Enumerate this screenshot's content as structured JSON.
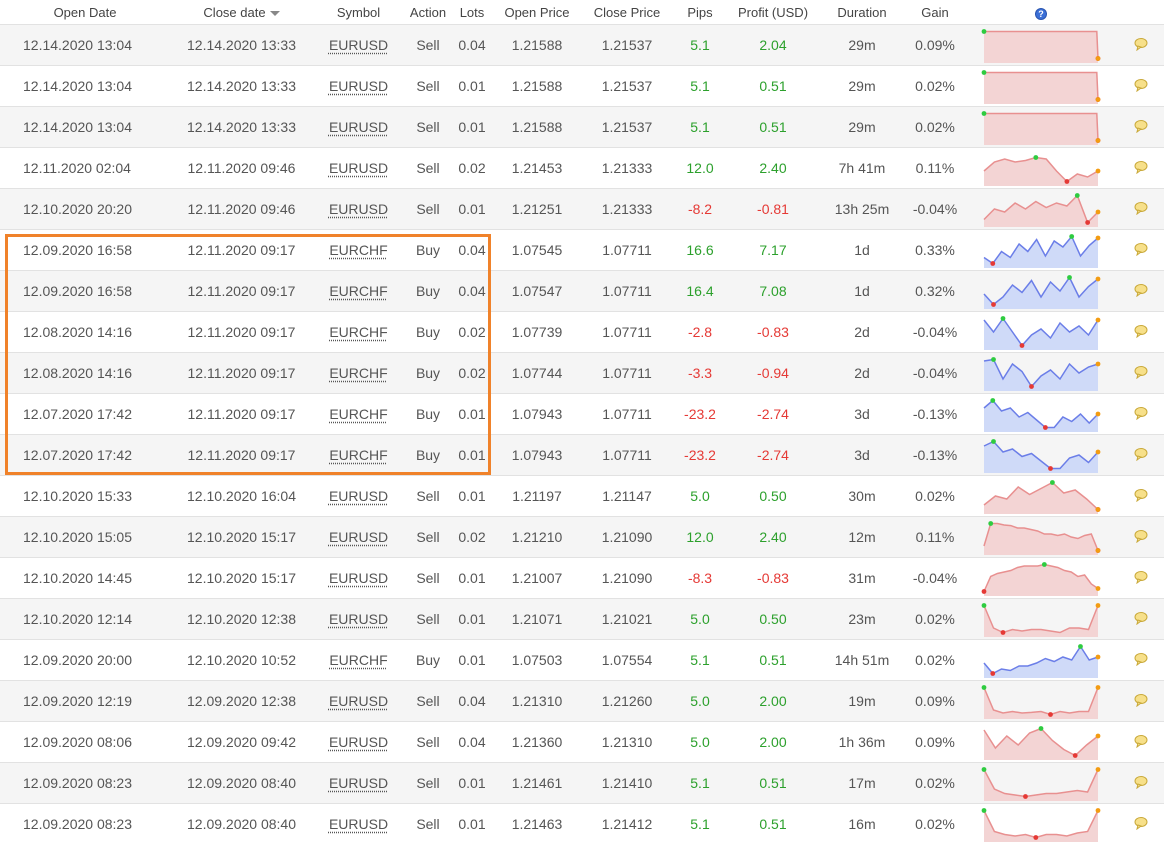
{
  "columns": {
    "open_date": "Open Date",
    "close_date": "Close date",
    "symbol": "Symbol",
    "action": "Action",
    "lots": "Lots",
    "open_price": "Open Price",
    "close_price": "Close Price",
    "pips": "Pips",
    "profit": "Profit (USD)",
    "duration": "Duration",
    "gain": "Gain",
    "help_icon_glyph": "?"
  },
  "colors": {
    "positive": "#2ca02c",
    "negative": "#e53935",
    "highlight_border": "#f0822a",
    "sell_line": "#e89090",
    "sell_fill": "#f3d4d4",
    "buy_line": "#6b7ee8",
    "buy_fill": "#cfdaf8"
  },
  "highlighted_rows": [
    5,
    6,
    7,
    8,
    9,
    10
  ],
  "rows": [
    {
      "open": "12.14.2020 13:04",
      "close": "12.14.2020 13:33",
      "symbol": "EURUSD",
      "action": "Sell",
      "lots": "0.04",
      "open_price": "1.21588",
      "close_price": "1.21537",
      "pips": "5.1",
      "profit": "2.04",
      "duration": "29m",
      "gain": "0.09%",
      "spark": [
        0.05,
        0.05,
        0.05,
        0.05,
        0.05,
        0.05,
        0.05,
        0.05,
        0.05,
        0.05,
        0.05,
        0.05,
        0.05,
        0.05,
        0.05,
        0.05,
        0.05,
        0.05,
        0.05,
        0.05,
        0.05,
        0.05,
        0.05,
        0.05,
        0.05,
        0.05,
        0.05,
        0.05,
        0.05,
        0.05,
        0.05,
        0.05,
        0.05,
        0.05,
        0.05,
        0.05,
        0.05,
        0.05,
        0.05,
        0.05,
        0.05,
        0.05,
        0.05,
        0.05,
        0.05,
        0.05,
        0.05,
        0.05,
        0.05,
        0.05,
        0.05,
        0.05,
        0.05,
        0.05,
        0.05,
        0.05,
        0.05,
        0.05,
        0.05,
        0.05,
        0.05,
        0.05,
        0.05,
        0.05,
        0.05,
        0.05,
        0.05,
        0.05,
        0.05,
        0.05,
        0.05,
        0.05,
        0.05,
        0.05,
        0.05,
        0.05,
        0.05,
        0.05,
        0.05,
        0.05,
        0.05,
        0.05,
        0.05,
        0.05,
        0.05,
        0.05,
        0.05,
        0.05,
        0.05,
        0.05,
        0.05,
        0.05,
        0.05,
        0.05,
        0.05,
        0.95
      ]
    },
    {
      "open": "12.14.2020 13:04",
      "close": "12.14.2020 13:33",
      "symbol": "EURUSD",
      "action": "Sell",
      "lots": "0.01",
      "open_price": "1.21588",
      "close_price": "1.21537",
      "pips": "5.1",
      "profit": "0.51",
      "duration": "29m",
      "gain": "0.02%",
      "spark": [
        0.05,
        0.05,
        0.05,
        0.05,
        0.05,
        0.05,
        0.05,
        0.05,
        0.05,
        0.05,
        0.05,
        0.05,
        0.05,
        0.05,
        0.05,
        0.05,
        0.05,
        0.05,
        0.05,
        0.05,
        0.05,
        0.05,
        0.05,
        0.05,
        0.05,
        0.05,
        0.05,
        0.05,
        0.05,
        0.05,
        0.05,
        0.05,
        0.05,
        0.05,
        0.05,
        0.05,
        0.05,
        0.05,
        0.05,
        0.05,
        0.05,
        0.05,
        0.05,
        0.05,
        0.05,
        0.05,
        0.05,
        0.05,
        0.05,
        0.05,
        0.05,
        0.05,
        0.05,
        0.05,
        0.05,
        0.05,
        0.05,
        0.05,
        0.05,
        0.05,
        0.05,
        0.05,
        0.05,
        0.05,
        0.05,
        0.05,
        0.05,
        0.05,
        0.05,
        0.05,
        0.05,
        0.05,
        0.05,
        0.05,
        0.05,
        0.05,
        0.05,
        0.05,
        0.05,
        0.05,
        0.05,
        0.05,
        0.05,
        0.05,
        0.05,
        0.05,
        0.05,
        0.05,
        0.05,
        0.05,
        0.05,
        0.05,
        0.05,
        0.05,
        0.05,
        0.95
      ]
    },
    {
      "open": "12.14.2020 13:04",
      "close": "12.14.2020 13:33",
      "symbol": "EURUSD",
      "action": "Sell",
      "lots": "0.01",
      "open_price": "1.21588",
      "close_price": "1.21537",
      "pips": "5.1",
      "profit": "0.51",
      "duration": "29m",
      "gain": "0.02%",
      "spark": [
        0.05,
        0.05,
        0.05,
        0.05,
        0.05,
        0.05,
        0.05,
        0.05,
        0.05,
        0.05,
        0.05,
        0.05,
        0.05,
        0.05,
        0.05,
        0.05,
        0.05,
        0.05,
        0.05,
        0.05,
        0.05,
        0.05,
        0.05,
        0.05,
        0.05,
        0.05,
        0.05,
        0.05,
        0.05,
        0.05,
        0.05,
        0.05,
        0.05,
        0.05,
        0.05,
        0.05,
        0.05,
        0.05,
        0.05,
        0.05,
        0.05,
        0.05,
        0.05,
        0.05,
        0.05,
        0.05,
        0.05,
        0.05,
        0.05,
        0.05,
        0.05,
        0.05,
        0.05,
        0.05,
        0.05,
        0.05,
        0.05,
        0.05,
        0.05,
        0.05,
        0.05,
        0.05,
        0.05,
        0.05,
        0.05,
        0.05,
        0.05,
        0.05,
        0.05,
        0.05,
        0.05,
        0.05,
        0.05,
        0.05,
        0.05,
        0.05,
        0.05,
        0.05,
        0.05,
        0.05,
        0.05,
        0.05,
        0.05,
        0.05,
        0.05,
        0.05,
        0.05,
        0.05,
        0.05,
        0.05,
        0.05,
        0.05,
        0.05,
        0.05,
        0.05,
        0.95
      ]
    },
    {
      "open": "12.11.2020 02:04",
      "close": "12.11.2020 09:46",
      "symbol": "EURUSD",
      "action": "Sell",
      "lots": "0.02",
      "open_price": "1.21453",
      "close_price": "1.21333",
      "pips": "12.0",
      "profit": "2.40",
      "duration": "7h 41m",
      "gain": "0.11%",
      "spark": [
        0.6,
        0.3,
        0.2,
        0.3,
        0.25,
        0.15,
        0.2,
        0.6,
        0.95,
        0.7,
        0.8,
        0.6
      ]
    },
    {
      "open": "12.10.2020 20:20",
      "close": "12.11.2020 09:46",
      "symbol": "EURUSD",
      "action": "Sell",
      "lots": "0.01",
      "open_price": "1.21251",
      "close_price": "1.21333",
      "pips": "-8.2",
      "profit": "-0.81",
      "duration": "13h 25m",
      "gain": "-0.04%",
      "spark": [
        0.85,
        0.5,
        0.6,
        0.3,
        0.5,
        0.25,
        0.45,
        0.3,
        0.4,
        0.05,
        0.95,
        0.6
      ]
    },
    {
      "open": "12.09.2020 16:58",
      "close": "12.11.2020 09:17",
      "symbol": "EURCHF",
      "action": "Buy",
      "lots": "0.04",
      "open_price": "1.07545",
      "close_price": "1.07711",
      "pips": "16.6",
      "profit": "7.17",
      "duration": "1d",
      "gain": "0.33%",
      "spark": [
        0.75,
        0.95,
        0.55,
        0.75,
        0.3,
        0.55,
        0.15,
        0.7,
        0.2,
        0.4,
        0.05,
        0.7,
        0.35,
        0.1
      ]
    },
    {
      "open": "12.09.2020 16:58",
      "close": "12.11.2020 09:17",
      "symbol": "EURCHF",
      "action": "Buy",
      "lots": "0.04",
      "open_price": "1.07547",
      "close_price": "1.07711",
      "pips": "16.4",
      "profit": "7.08",
      "duration": "1d",
      "gain": "0.32%",
      "spark": [
        0.6,
        0.95,
        0.7,
        0.3,
        0.55,
        0.15,
        0.7,
        0.2,
        0.5,
        0.05,
        0.7,
        0.35,
        0.1
      ]
    },
    {
      "open": "12.08.2020 14:16",
      "close": "12.11.2020 09:17",
      "symbol": "EURCHF",
      "action": "Buy",
      "lots": "0.02",
      "open_price": "1.07739",
      "close_price": "1.07711",
      "pips": "-2.8",
      "profit": "-0.83",
      "duration": "2d",
      "gain": "-0.04%",
      "spark": [
        0.1,
        0.5,
        0.05,
        0.5,
        0.95,
        0.6,
        0.4,
        0.7,
        0.2,
        0.5,
        0.3,
        0.6,
        0.1
      ]
    },
    {
      "open": "12.08.2020 14:16",
      "close": "12.11.2020 09:17",
      "symbol": "EURCHF",
      "action": "Buy",
      "lots": "0.02",
      "open_price": "1.07744",
      "close_price": "1.07711",
      "pips": "-3.3",
      "profit": "-0.94",
      "duration": "2d",
      "gain": "-0.04%",
      "spark": [
        0.1,
        0.05,
        0.7,
        0.2,
        0.45,
        0.95,
        0.6,
        0.4,
        0.7,
        0.2,
        0.5,
        0.3,
        0.2
      ]
    },
    {
      "open": "12.07.2020 17:42",
      "close": "12.11.2020 09:17",
      "symbol": "EURCHF",
      "action": "Buy",
      "lots": "0.01",
      "open_price": "1.07943",
      "close_price": "1.07711",
      "pips": "-23.2",
      "profit": "-2.74",
      "duration": "3d",
      "gain": "-0.13%",
      "spark": [
        0.3,
        0.05,
        0.4,
        0.3,
        0.6,
        0.45,
        0.7,
        0.95,
        0.95,
        0.6,
        0.75,
        0.5,
        0.8,
        0.5
      ]
    },
    {
      "open": "12.07.2020 17:42",
      "close": "12.11.2020 09:17",
      "symbol": "EURCHF",
      "action": "Buy",
      "lots": "0.01",
      "open_price": "1.07943",
      "close_price": "1.07711",
      "pips": "-23.2",
      "profit": "-2.74",
      "duration": "3d",
      "gain": "-0.13%",
      "spark": [
        0.2,
        0.05,
        0.4,
        0.3,
        0.55,
        0.45,
        0.7,
        0.95,
        0.95,
        0.6,
        0.5,
        0.75,
        0.4
      ]
    },
    {
      "open": "12.10.2020 15:33",
      "close": "12.10.2020 16:04",
      "symbol": "EURUSD",
      "action": "Sell",
      "lots": "0.01",
      "open_price": "1.21197",
      "close_price": "1.21147",
      "pips": "5.0",
      "profit": "0.50",
      "duration": "30m",
      "gain": "0.02%",
      "spark": [
        0.8,
        0.5,
        0.6,
        0.2,
        0.45,
        0.25,
        0.05,
        0.4,
        0.3,
        0.6,
        0.95
      ]
    },
    {
      "open": "12.10.2020 15:05",
      "close": "12.10.2020 15:17",
      "symbol": "EURUSD",
      "action": "Sell",
      "lots": "0.02",
      "open_price": "1.21210",
      "close_price": "1.21090",
      "pips": "12.0",
      "profit": "2.40",
      "duration": "12m",
      "gain": "0.11%",
      "spark": [
        0.8,
        0.05,
        0.05,
        0.1,
        0.12,
        0.2,
        0.2,
        0.25,
        0.3,
        0.4,
        0.4,
        0.45,
        0.4,
        0.5,
        0.55,
        0.45,
        0.4,
        0.95
      ]
    },
    {
      "open": "12.10.2020 14:45",
      "close": "12.10.2020 15:17",
      "symbol": "EURUSD",
      "action": "Sell",
      "lots": "0.01",
      "open_price": "1.21007",
      "close_price": "1.21090",
      "pips": "-8.3",
      "profit": "-0.83",
      "duration": "31m",
      "gain": "-0.04%",
      "spark": [
        0.95,
        0.45,
        0.35,
        0.3,
        0.25,
        0.15,
        0.1,
        0.1,
        0.1,
        0.05,
        0.1,
        0.15,
        0.25,
        0.3,
        0.45,
        0.4,
        0.7,
        0.85
      ]
    },
    {
      "open": "12.10.2020 12:14",
      "close": "12.10.2020 12:38",
      "symbol": "EURUSD",
      "action": "Sell",
      "lots": "0.01",
      "open_price": "1.21071",
      "close_price": "1.21021",
      "pips": "5.0",
      "profit": "0.50",
      "duration": "23m",
      "gain": "0.02%",
      "spark": [
        0.05,
        0.8,
        0.95,
        0.85,
        0.9,
        0.85,
        0.85,
        0.9,
        0.95,
        0.8,
        0.8,
        0.85,
        0.05
      ]
    },
    {
      "open": "12.09.2020 20:00",
      "close": "12.10.2020 10:52",
      "symbol": "EURCHF",
      "action": "Buy",
      "lots": "0.01",
      "open_price": "1.07503",
      "close_price": "1.07554",
      "pips": "5.1",
      "profit": "0.51",
      "duration": "14h 51m",
      "gain": "0.02%",
      "spark": [
        0.6,
        0.95,
        0.8,
        0.85,
        0.7,
        0.7,
        0.6,
        0.45,
        0.55,
        0.4,
        0.5,
        0.05,
        0.5,
        0.4
      ]
    },
    {
      "open": "12.09.2020 12:19",
      "close": "12.09.2020 12:38",
      "symbol": "EURUSD",
      "action": "Sell",
      "lots": "0.04",
      "open_price": "1.21310",
      "close_price": "1.21260",
      "pips": "5.0",
      "profit": "2.00",
      "duration": "19m",
      "gain": "0.09%",
      "spark": [
        0.05,
        0.8,
        0.9,
        0.85,
        0.9,
        0.88,
        0.85,
        0.95,
        0.85,
        0.9,
        0.85,
        0.85,
        0.05
      ]
    },
    {
      "open": "12.09.2020 08:06",
      "close": "12.09.2020 09:42",
      "symbol": "EURUSD",
      "action": "Sell",
      "lots": "0.04",
      "open_price": "1.21360",
      "close_price": "1.21310",
      "pips": "5.0",
      "profit": "2.00",
      "duration": "1h 36m",
      "gain": "0.09%",
      "spark": [
        0.1,
        0.7,
        0.3,
        0.6,
        0.2,
        0.05,
        0.45,
        0.75,
        0.95,
        0.6,
        0.3
      ]
    },
    {
      "open": "12.09.2020 08:23",
      "close": "12.09.2020 08:40",
      "symbol": "EURUSD",
      "action": "Sell",
      "lots": "0.01",
      "open_price": "1.21461",
      "close_price": "1.21410",
      "pips": "5.1",
      "profit": "0.51",
      "duration": "17m",
      "gain": "0.02%",
      "spark": [
        0.05,
        0.7,
        0.85,
        0.9,
        0.95,
        0.9,
        0.85,
        0.85,
        0.8,
        0.75,
        0.8,
        0.05
      ]
    },
    {
      "open": "12.09.2020 08:23",
      "close": "12.09.2020 08:40",
      "symbol": "EURUSD",
      "action": "Sell",
      "lots": "0.01",
      "open_price": "1.21463",
      "close_price": "1.21412",
      "pips": "5.1",
      "profit": "0.51",
      "duration": "16m",
      "gain": "0.02%",
      "spark": [
        0.05,
        0.75,
        0.85,
        0.9,
        0.85,
        0.95,
        0.85,
        0.85,
        0.9,
        0.8,
        0.75,
        0.05
      ]
    }
  ]
}
